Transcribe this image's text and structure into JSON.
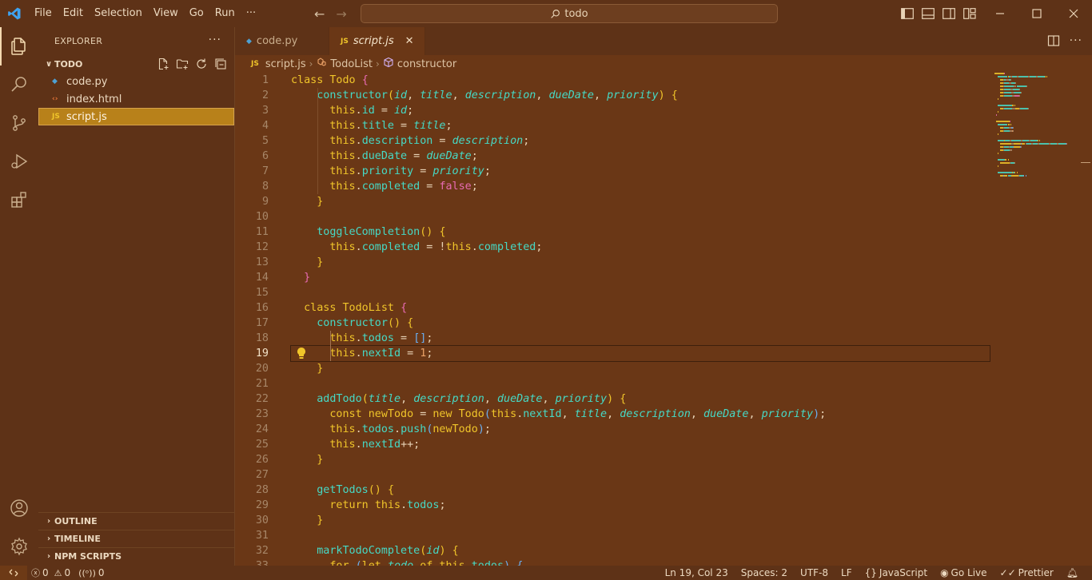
{
  "menu": [
    "File",
    "Edit",
    "Selection",
    "View",
    "Go",
    "Run",
    "···"
  ],
  "search": {
    "text": "todo"
  },
  "explorer": {
    "title": "EXPLORER",
    "folder": "TODO",
    "files": [
      {
        "name": "code.py",
        "kind": "python",
        "icon": "python-icon"
      },
      {
        "name": "index.html",
        "kind": "html",
        "icon": "html-icon"
      },
      {
        "name": "script.js",
        "kind": "js",
        "icon": "js-icon",
        "selected": true
      }
    ],
    "sections": [
      "OUTLINE",
      "TIMELINE",
      "NPM SCRIPTS"
    ]
  },
  "tabs": [
    {
      "label": "code.py",
      "icon": "python-icon",
      "active": false
    },
    {
      "label": "script.js",
      "icon": "js-icon",
      "active": true
    }
  ],
  "breadcrumb": [
    "script.js",
    "TodoList",
    "constructor"
  ],
  "editor": {
    "current_line": 19,
    "lines": [
      [
        [
          "kw",
          "class "
        ],
        [
          "cls",
          "Todo "
        ],
        [
          "b1",
          "{"
        ]
      ],
      [
        [
          "p",
          "    "
        ],
        [
          "fn",
          "constructor"
        ],
        [
          "b2",
          "("
        ],
        [
          "par",
          "id"
        ],
        [
          "p",
          ", "
        ],
        [
          "par",
          "title"
        ],
        [
          "p",
          ", "
        ],
        [
          "par",
          "description"
        ],
        [
          "p",
          ", "
        ],
        [
          "par",
          "dueDate"
        ],
        [
          "p",
          ", "
        ],
        [
          "par",
          "priority"
        ],
        [
          "b2",
          ")"
        ],
        [
          "p",
          " "
        ],
        [
          "b2",
          "{"
        ]
      ],
      [
        [
          "p",
          "      "
        ],
        [
          "this",
          "this"
        ],
        [
          "p",
          "."
        ],
        [
          "prop",
          "id"
        ],
        [
          "p",
          " = "
        ],
        [
          "par",
          "id"
        ],
        [
          "p",
          ";"
        ]
      ],
      [
        [
          "p",
          "      "
        ],
        [
          "this",
          "this"
        ],
        [
          "p",
          "."
        ],
        [
          "prop",
          "title"
        ],
        [
          "p",
          " = "
        ],
        [
          "par",
          "title"
        ],
        [
          "p",
          ";"
        ]
      ],
      [
        [
          "p",
          "      "
        ],
        [
          "this",
          "this"
        ],
        [
          "p",
          "."
        ],
        [
          "prop",
          "description"
        ],
        [
          "p",
          " = "
        ],
        [
          "par",
          "description"
        ],
        [
          "p",
          ";"
        ]
      ],
      [
        [
          "p",
          "      "
        ],
        [
          "this",
          "this"
        ],
        [
          "p",
          "."
        ],
        [
          "prop",
          "dueDate"
        ],
        [
          "p",
          " = "
        ],
        [
          "par",
          "dueDate"
        ],
        [
          "p",
          ";"
        ]
      ],
      [
        [
          "p",
          "      "
        ],
        [
          "this",
          "this"
        ],
        [
          "p",
          "."
        ],
        [
          "prop",
          "priority"
        ],
        [
          "p",
          " = "
        ],
        [
          "par",
          "priority"
        ],
        [
          "p",
          ";"
        ]
      ],
      [
        [
          "p",
          "      "
        ],
        [
          "this",
          "this"
        ],
        [
          "p",
          "."
        ],
        [
          "prop",
          "completed"
        ],
        [
          "p",
          " = "
        ],
        [
          "bool",
          "false"
        ],
        [
          "p",
          ";"
        ]
      ],
      [
        [
          "p",
          "    "
        ],
        [
          "b2",
          "}"
        ]
      ],
      [],
      [
        [
          "p",
          "    "
        ],
        [
          "fn",
          "toggleCompletion"
        ],
        [
          "b2",
          "()"
        ],
        [
          "p",
          " "
        ],
        [
          "b2",
          "{"
        ]
      ],
      [
        [
          "p",
          "      "
        ],
        [
          "this",
          "this"
        ],
        [
          "p",
          "."
        ],
        [
          "prop",
          "completed"
        ],
        [
          "p",
          " = !"
        ],
        [
          "this",
          "this"
        ],
        [
          "p",
          "."
        ],
        [
          "prop",
          "completed"
        ],
        [
          "p",
          ";"
        ]
      ],
      [
        [
          "p",
          "    "
        ],
        [
          "b2",
          "}"
        ]
      ],
      [
        [
          "p",
          "  "
        ],
        [
          "b1",
          "}"
        ]
      ],
      [],
      [
        [
          "p",
          "  "
        ],
        [
          "kw",
          "class "
        ],
        [
          "cls",
          "TodoList "
        ],
        [
          "b1",
          "{"
        ]
      ],
      [
        [
          "p",
          "    "
        ],
        [
          "fn",
          "constructor"
        ],
        [
          "b2",
          "()"
        ],
        [
          "p",
          " "
        ],
        [
          "b2",
          "{"
        ]
      ],
      [
        [
          "p",
          "      "
        ],
        [
          "this",
          "this"
        ],
        [
          "p",
          "."
        ],
        [
          "prop",
          "todos"
        ],
        [
          "p",
          " = "
        ],
        [
          "b3",
          "[]"
        ],
        [
          "p",
          ";"
        ]
      ],
      [
        [
          "p",
          "      "
        ],
        [
          "this",
          "this"
        ],
        [
          "p",
          "."
        ],
        [
          "prop",
          "nextId"
        ],
        [
          "p",
          " = "
        ],
        [
          "num",
          "1"
        ],
        [
          "p",
          ";"
        ]
      ],
      [
        [
          "p",
          "    "
        ],
        [
          "b2",
          "}"
        ]
      ],
      [],
      [
        [
          "p",
          "    "
        ],
        [
          "fn",
          "addTodo"
        ],
        [
          "b2",
          "("
        ],
        [
          "par",
          "title"
        ],
        [
          "p",
          ", "
        ],
        [
          "par",
          "description"
        ],
        [
          "p",
          ", "
        ],
        [
          "par",
          "dueDate"
        ],
        [
          "p",
          ", "
        ],
        [
          "par",
          "priority"
        ],
        [
          "b2",
          ")"
        ],
        [
          "p",
          " "
        ],
        [
          "b2",
          "{"
        ]
      ],
      [
        [
          "p",
          "      "
        ],
        [
          "kw",
          "const "
        ],
        [
          "cls",
          "newTodo"
        ],
        [
          "p",
          " = "
        ],
        [
          "kw",
          "new "
        ],
        [
          "cls",
          "Todo"
        ],
        [
          "b3",
          "("
        ],
        [
          "this",
          "this"
        ],
        [
          "p",
          "."
        ],
        [
          "prop",
          "nextId"
        ],
        [
          "p",
          ", "
        ],
        [
          "par",
          "title"
        ],
        [
          "p",
          ", "
        ],
        [
          "par",
          "description"
        ],
        [
          "p",
          ", "
        ],
        [
          "par",
          "dueDate"
        ],
        [
          "p",
          ", "
        ],
        [
          "par",
          "priority"
        ],
        [
          "b3",
          ")"
        ],
        [
          "p",
          ";"
        ]
      ],
      [
        [
          "p",
          "      "
        ],
        [
          "this",
          "this"
        ],
        [
          "p",
          "."
        ],
        [
          "prop",
          "todos"
        ],
        [
          "p",
          "."
        ],
        [
          "fn",
          "push"
        ],
        [
          "b3",
          "("
        ],
        [
          "cls",
          "newTodo"
        ],
        [
          "b3",
          ")"
        ],
        [
          "p",
          ";"
        ]
      ],
      [
        [
          "p",
          "      "
        ],
        [
          "this",
          "this"
        ],
        [
          "p",
          "."
        ],
        [
          "prop",
          "nextId"
        ],
        [
          "p",
          "++;"
        ]
      ],
      [
        [
          "p",
          "    "
        ],
        [
          "b2",
          "}"
        ]
      ],
      [],
      [
        [
          "p",
          "    "
        ],
        [
          "fn",
          "getTodos"
        ],
        [
          "b2",
          "()"
        ],
        [
          "p",
          " "
        ],
        [
          "b2",
          "{"
        ]
      ],
      [
        [
          "p",
          "      "
        ],
        [
          "kw",
          "return "
        ],
        [
          "this",
          "this"
        ],
        [
          "p",
          "."
        ],
        [
          "prop",
          "todos"
        ],
        [
          "p",
          ";"
        ]
      ],
      [
        [
          "p",
          "    "
        ],
        [
          "b2",
          "}"
        ]
      ],
      [],
      [
        [
          "p",
          "    "
        ],
        [
          "fn",
          "markTodoComplete"
        ],
        [
          "b2",
          "("
        ],
        [
          "par",
          "id"
        ],
        [
          "b2",
          ")"
        ],
        [
          "p",
          " "
        ],
        [
          "b2",
          "{"
        ]
      ],
      [
        [
          "p",
          "      "
        ],
        [
          "kw",
          "for "
        ],
        [
          "b3",
          "("
        ],
        [
          "kw",
          "let "
        ],
        [
          "par",
          "todo"
        ],
        [
          "kw",
          " of "
        ],
        [
          "this",
          "this"
        ],
        [
          "p",
          "."
        ],
        [
          "prop",
          "todos"
        ],
        [
          "b3",
          ")"
        ],
        [
          "p",
          " "
        ],
        [
          "b3",
          "{"
        ]
      ]
    ]
  },
  "status": {
    "errors": "0",
    "warnings": "0",
    "ports": "0",
    "position": "Ln 19, Col 23",
    "spaces": "Spaces: 2",
    "encoding": "UTF-8",
    "eol": "LF",
    "language": "JavaScript",
    "golive": "Go Live",
    "prettier": "Prettier"
  },
  "colors": {
    "background": "#5e3217",
    "editor": "#6a3716",
    "selection": "#b8811a",
    "keyword": "#f0c52a",
    "function": "#46d9c5"
  }
}
